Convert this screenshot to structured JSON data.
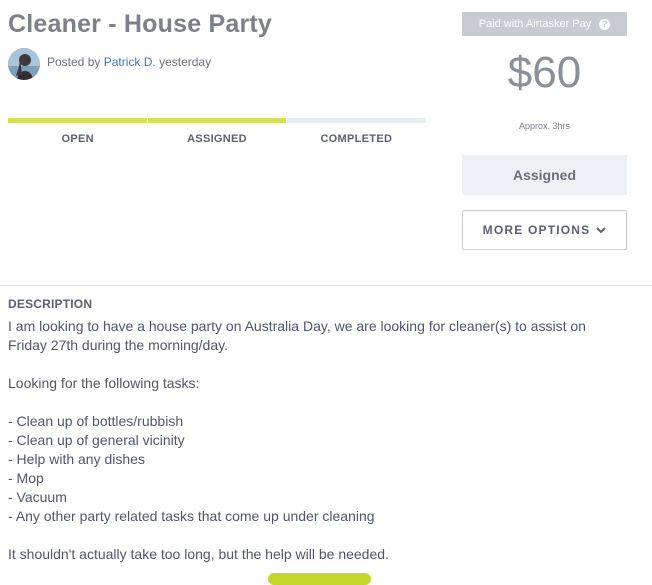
{
  "task": {
    "title": "Cleaner - House Party",
    "posted_prefix": "Posted by",
    "author": "Patrick D.",
    "posted_time": "yesterday"
  },
  "progress": {
    "stages": [
      {
        "label": "OPEN",
        "active": true
      },
      {
        "label": "ASSIGNED",
        "active": true
      },
      {
        "label": "COMPLETED",
        "active": false
      }
    ],
    "active_color": "#d4e157",
    "inactive_color": "#e8edef"
  },
  "price_card": {
    "payment_label": "Paid with Airtasker Pay",
    "help_icon": "?",
    "amount": "$60",
    "approx": "Approx. 3hrs",
    "status": "Assigned"
  },
  "more_options": {
    "label": "MORE OPTIONS"
  },
  "description": {
    "heading": "DESCRIPTION",
    "intro": "I am looking to have a house party on Australia Day, we are looking for cleaner(s) to assist on Friday 27th during the morning/day.",
    "tasks_heading": "Looking for the following tasks:",
    "tasks": [
      "- Clean up of bottles/rubbish",
      "- Clean up of general vicinity",
      "- Help with any dishes",
      "- Mop",
      "- Vacuum",
      "- Any other party related tasks that come up under cleaning"
    ],
    "closing": "It shouldn't actually take too long, but the help will be needed."
  }
}
